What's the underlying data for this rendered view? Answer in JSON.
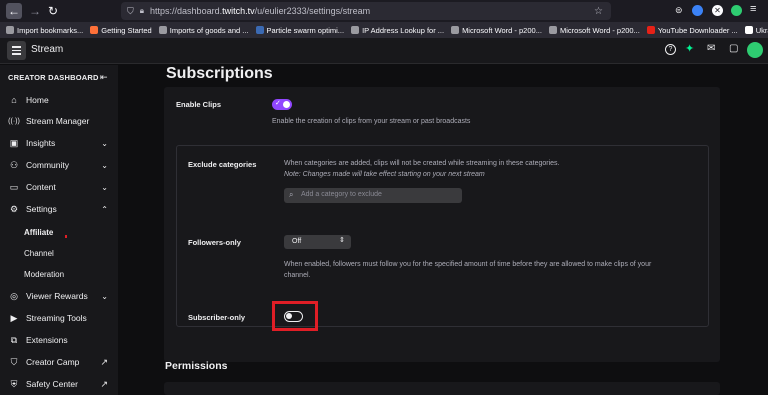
{
  "browser": {
    "url_prefix": "https://dashboard.",
    "url_domain": "twitch.tv",
    "url_path": "/u/eulier2333/settings/stream",
    "bookmarks": [
      {
        "label": "Import bookmarks...",
        "color": "#9a9aa0"
      },
      {
        "label": "Getting Started",
        "color": "#ff7139"
      },
      {
        "label": "Imports of goods and ...",
        "color": "#9a9aa0"
      },
      {
        "label": "Particle swarm optimi...",
        "color": "#3b6ab3"
      },
      {
        "label": "IP Address Lookup for ...",
        "color": "#9a9aa0"
      },
      {
        "label": "Microsoft Word - p200...",
        "color": "#9a9aa0"
      },
      {
        "label": "Microsoft Word - p200...",
        "color": "#9a9aa0"
      },
      {
        "label": "YouTube Downloader ...",
        "color": "#e62117"
      },
      {
        "label": "Ukraine maps: Trackin...",
        "color": "#ffffff"
      }
    ]
  },
  "topbar": {
    "title": "Stream"
  },
  "sidebar": {
    "header": "CREATOR DASHBOARD",
    "items": [
      {
        "label": "Home",
        "icon": "⌂",
        "name": "home"
      },
      {
        "label": "Stream Manager",
        "icon": "((·))",
        "name": "stream-manager"
      },
      {
        "label": "Insights",
        "icon": "▣",
        "name": "insights"
      },
      {
        "label": "Community",
        "icon": "⚇",
        "name": "community"
      },
      {
        "label": "Content",
        "icon": "▭",
        "name": "content"
      },
      {
        "label": "Settings",
        "icon": "⚙",
        "name": "settings"
      }
    ],
    "settings_sub": [
      "Affiliate",
      "Channel",
      "Moderation"
    ],
    "items2": [
      {
        "label": "Viewer Rewards",
        "icon": "◎",
        "name": "viewer-rewards"
      },
      {
        "label": "Streaming Tools",
        "icon": "▶",
        "name": "streaming-tools"
      },
      {
        "label": "Extensions",
        "icon": "⧉",
        "name": "extensions"
      },
      {
        "label": "Creator Camp",
        "icon": "⛉",
        "name": "creator-camp"
      },
      {
        "label": "Safety Center",
        "icon": "⛨",
        "name": "safety-center"
      }
    ]
  },
  "main": {
    "section_title": "Subscriptions",
    "enable_clips_label": "Enable Clips",
    "enable_clips_desc": "Enable the creation of clips from your stream or past broadcasts",
    "enable_clips_on": true,
    "exclude_label": "Exclude categories",
    "exclude_desc": "When categories are added, clips will not be created while streaming in these categories.",
    "exclude_note": "Note: Changes made will take effect starting on your next stream",
    "exclude_placeholder": "Add a category to exclude",
    "followers_label": "Followers-only",
    "followers_value": "Off",
    "followers_desc_1": "When enabled, followers must follow you for the specified amount of time before they are allowed to make clips of your",
    "followers_desc_2": "channel.",
    "subscriber_label": "Subscriber-only",
    "subscriber_on": false,
    "permissions_title": "Permissions"
  },
  "colors": {
    "accent": "#9147ff",
    "highlight": "#e01e26",
    "avatar": "#2ecc71"
  }
}
